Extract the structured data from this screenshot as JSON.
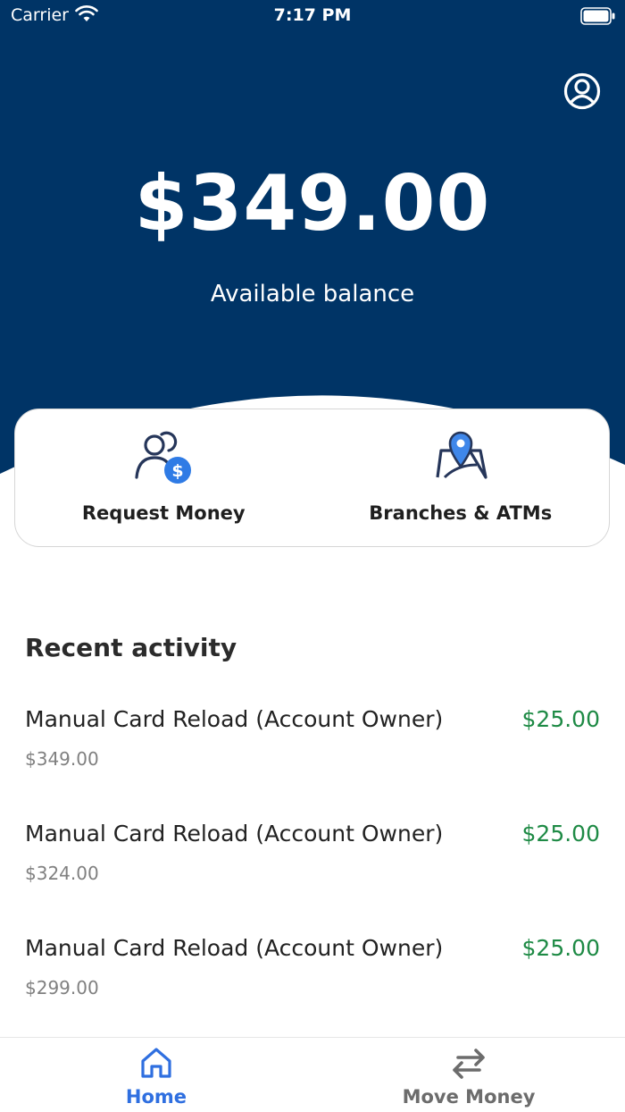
{
  "status_bar": {
    "carrier": "Carrier",
    "time": "7:17 PM"
  },
  "header": {
    "background_color": "#003466",
    "balance": "$349.00",
    "balance_label": "Available balance",
    "profile_icon": "user-circle-icon"
  },
  "actions": [
    {
      "label": "Request Money",
      "icon": "request-money-icon"
    },
    {
      "label": "Branches & ATMs",
      "icon": "map-pin-icon"
    }
  ],
  "recent_activity": {
    "title": "Recent activity",
    "items": [
      {
        "description": "Manual Card Reload (Account Owner)",
        "amount": "$25.00",
        "balance": "$349.00"
      },
      {
        "description": "Manual Card Reload (Account Owner)",
        "amount": "$25.00",
        "balance": "$324.00"
      },
      {
        "description": "Manual Card Reload (Account Owner)",
        "amount": "$25.00",
        "balance": "$299.00"
      }
    ]
  },
  "bottom_nav": [
    {
      "label": "Home",
      "icon": "home-icon",
      "active": true
    },
    {
      "label": "Move Money",
      "icon": "transfer-arrows-icon",
      "active": false
    }
  ],
  "colors": {
    "accent_blue": "#2f6fe0",
    "amount_green": "#1e8a45",
    "header_navy": "#003466"
  }
}
